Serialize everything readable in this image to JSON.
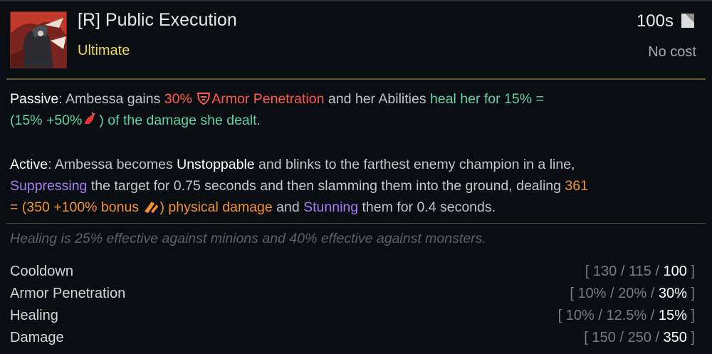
{
  "header": {
    "title": "[R] Public Execution",
    "subtitle": "Ultimate",
    "cooldown": "100s",
    "cost": "No cost"
  },
  "passive": {
    "label": "Passive",
    "t1": ": Ambessa gains ",
    "armor_pct": "30%",
    "armor_pen": "Armor Penetration",
    "t2": " and her Abilities ",
    "heal_text": "heal her for 15% =",
    "heal_formula": "(15% +50%",
    "heal_end": ") of the damage she dealt."
  },
  "active": {
    "label": "Active",
    "t1": ": Ambessa becomes ",
    "unstoppable": "Unstoppable",
    "t2": " and blinks to the farthest enemy champion in a line,",
    "suppressing": "Suppressing",
    "t3": " the target for 0.75 seconds and then slamming them into the ground, dealing ",
    "dmg_value": "361",
    "dmg_formula": "= (350 +100% bonus ",
    "dmg_end": ") physical damage",
    "t4": " and ",
    "stunning": "Stunning",
    "t5": " them for 0.4 seconds."
  },
  "note": "Healing is 25% effective against minions and 40% effective against monsters.",
  "stats": [
    {
      "name": "Cooldown",
      "values": [
        "130",
        "115",
        "100"
      ],
      "suffix": ""
    },
    {
      "name": "Armor Penetration",
      "values": [
        "10%",
        "20%",
        "30%"
      ],
      "suffix": ""
    },
    {
      "name": "Healing",
      "values": [
        "10%",
        "12.5%",
        "15%"
      ],
      "suffix": ""
    },
    {
      "name": "Damage",
      "values": [
        "150",
        "250",
        "350"
      ],
      "suffix": ""
    }
  ],
  "icons": {
    "portrait": "ambessa-ultimate-portrait",
    "cooldown": "cooldown-icon",
    "armor_pen": "armor-penetration-icon",
    "omnivamp": "omnivamp-icon",
    "bonus_ad": "bonus-attack-damage-icon"
  },
  "colors": {
    "title": "#e6e6e6",
    "subtitle": "#e8d85a",
    "armor_pen": "#ff5a4a",
    "physical": "#f7932f",
    "heal": "#61d2a2",
    "cc": "#a67cf4",
    "divider": "#61583c"
  }
}
